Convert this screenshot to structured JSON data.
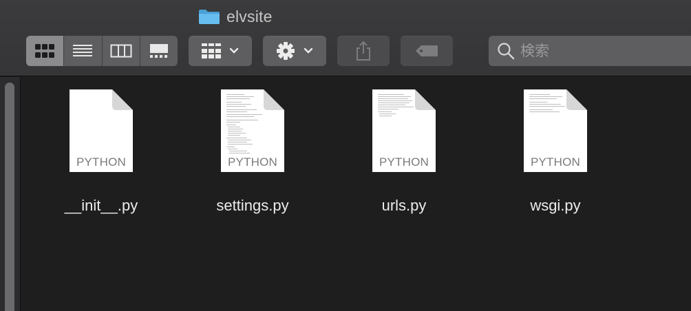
{
  "window": {
    "title": "elvsite"
  },
  "toolbar": {
    "view_modes": [
      {
        "name": "icon-view",
        "active": true
      },
      {
        "name": "list-view",
        "active": false
      },
      {
        "name": "column-view",
        "active": false
      },
      {
        "name": "gallery-view",
        "active": false
      }
    ],
    "group_button_icon": "grid-icon",
    "action_button_icon": "gear-icon",
    "share_button_icon": "share-icon",
    "tags_button_icon": "tag-icon",
    "search": {
      "placeholder": "検索",
      "value": ""
    }
  },
  "files": [
    {
      "name": "__init__.py",
      "kind": "PYTHON",
      "has_preview": false
    },
    {
      "name": "settings.py",
      "kind": "PYTHON",
      "has_preview": true
    },
    {
      "name": "urls.py",
      "kind": "PYTHON",
      "has_preview": true
    },
    {
      "name": "wsgi.py",
      "kind": "PYTHON",
      "has_preview": true
    }
  ],
  "colors": {
    "toolbar_bg": "#3a3a3c",
    "content_bg": "#1e1e1f",
    "button_bg": "#5e5e60",
    "folder_blue": "#5fb6e8"
  }
}
